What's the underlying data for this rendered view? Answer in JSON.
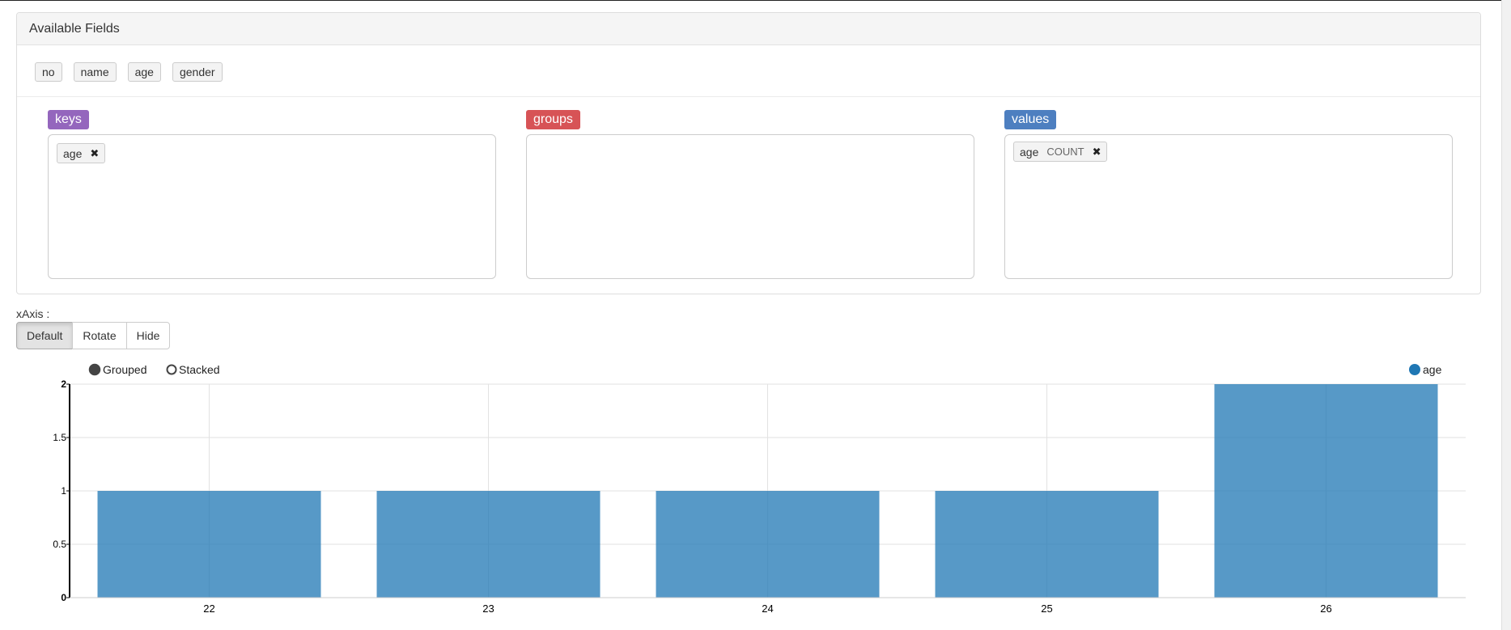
{
  "panel": {
    "title": "Available Fields",
    "fields": [
      "no",
      "name",
      "age",
      "gender"
    ]
  },
  "dropzones": {
    "keys": {
      "label": "keys",
      "color": "#9466bd",
      "items": [
        {
          "name": "age"
        }
      ]
    },
    "groups": {
      "label": "groups",
      "color": "#d75356",
      "items": []
    },
    "values": {
      "label": "values",
      "color": "#4d7fc0",
      "items": [
        {
          "name": "age",
          "agg": "COUNT"
        }
      ]
    }
  },
  "xaxis": {
    "label": "xAxis :",
    "buttons": [
      "Default",
      "Rotate",
      "Hide"
    ],
    "active": "Default"
  },
  "chart_controls": {
    "grouped": "Grouped",
    "stacked": "Stacked",
    "mode": "grouped"
  },
  "chart_data": {
    "type": "bar",
    "categories": [
      "22",
      "23",
      "24",
      "25",
      "26"
    ],
    "series": [
      {
        "name": "age",
        "values": [
          1,
          1,
          1,
          1,
          2
        ],
        "color": "#1f77b4"
      }
    ],
    "ylim": [
      0,
      2
    ],
    "yticks": [
      "0",
      "0.5",
      "1",
      "1.5",
      "2"
    ],
    "grid": true,
    "legend_position": "top-right"
  }
}
